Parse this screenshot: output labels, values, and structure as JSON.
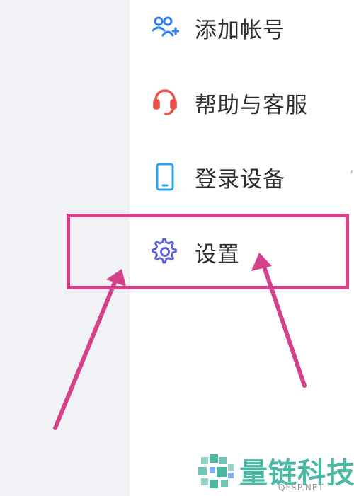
{
  "menu": {
    "items": [
      {
        "label": "添加帐号",
        "icon": "add-account-icon",
        "color": "#2f7cf6"
      },
      {
        "label": "帮助与客服",
        "icon": "headset-icon",
        "color": "#e9514a"
      },
      {
        "label": "登录设备",
        "icon": "phone-icon",
        "color": "#2aa5e8"
      },
      {
        "label": "设置",
        "icon": "gear-icon",
        "color": "#5b63d6"
      }
    ]
  },
  "annotation": {
    "color": "#d6428a",
    "highlighted_item": "设置"
  },
  "watermark": {
    "title": "量链科技",
    "subtitle": "QFSP.NET",
    "color": "#4cb8a4"
  }
}
